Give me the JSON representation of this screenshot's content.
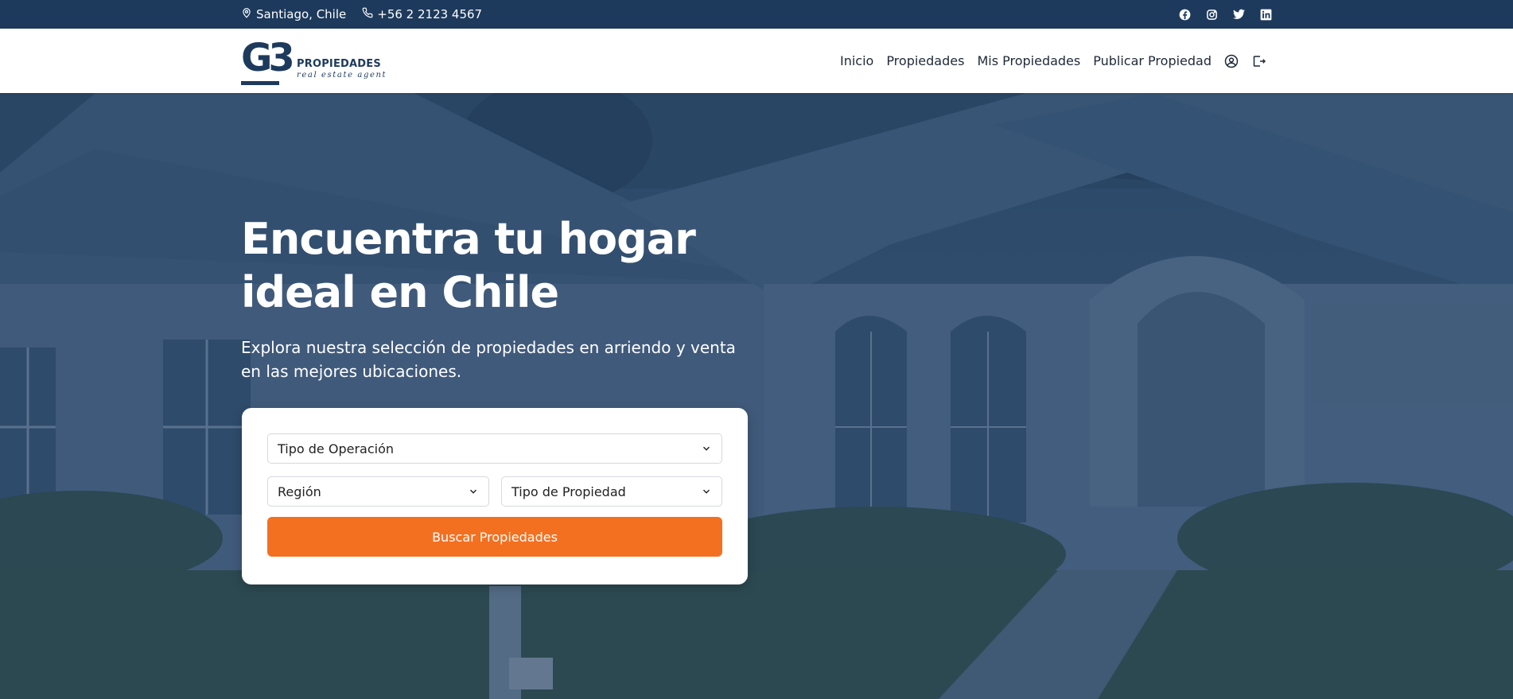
{
  "topbar": {
    "location": "Santiago, Chile",
    "phone": "+56 2 2123 4567",
    "social": [
      "facebook-icon",
      "instagram-icon",
      "twitter-icon",
      "linkedin-icon"
    ]
  },
  "logo": {
    "mark": "G3",
    "name": "PROPIEDADES",
    "tagline": "real estate agent"
  },
  "nav": {
    "items": [
      {
        "label": "Inicio"
      },
      {
        "label": "Propiedades"
      },
      {
        "label": "Mis Propiedades"
      },
      {
        "label": "Publicar Propiedad"
      }
    ],
    "icons": [
      "user-icon",
      "logout-icon"
    ]
  },
  "hero": {
    "title": "Encuentra tu hogar ideal en Chile",
    "subtitle": "Explora nuestra selección de propiedades en arriendo y venta en las mejores ubicaciones."
  },
  "search": {
    "operation_type": "Tipo de Operación",
    "region": "Región",
    "property_type": "Tipo de Propiedad",
    "button": "Buscar Propiedades"
  },
  "colors": {
    "primary": "#1d3a5c",
    "accent": "#f37021"
  }
}
